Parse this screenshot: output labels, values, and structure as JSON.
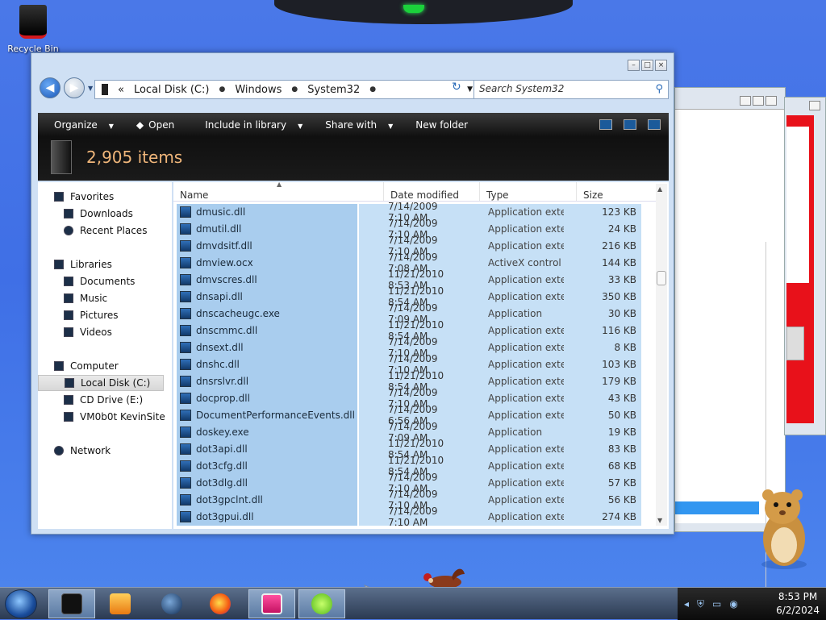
{
  "desktop": {
    "recycle_label": "Recycle Bin"
  },
  "window": {
    "nav": {
      "back": "◀",
      "forward": "▶"
    },
    "breadcrumb": [
      "Local Disk (C:)",
      "Windows",
      "System32"
    ],
    "search_placeholder": "Search System32",
    "toolbar": {
      "organize": "Organize",
      "open": "Open",
      "include": "Include in library",
      "share": "Share with",
      "new_folder": "New folder"
    },
    "item_count": "2,905 items",
    "sidebar": {
      "favorites": "Favorites",
      "downloads": "Downloads",
      "recent": "Recent Places",
      "libraries": "Libraries",
      "documents": "Documents",
      "music": "Music",
      "pictures": "Pictures",
      "videos": "Videos",
      "computer": "Computer",
      "local_disk": "Local Disk (C:)",
      "cd_drive": "CD Drive (E:)",
      "vm": "VM0b0t KevinSite",
      "network": "Network"
    },
    "columns": {
      "name": "Name",
      "date": "Date modified",
      "type": "Type",
      "size": "Size"
    },
    "files": [
      {
        "name": "dmusic.dll",
        "date": "7/14/2009 7:10 AM",
        "type": "Application extens...",
        "size": "123 KB"
      },
      {
        "name": "dmutil.dll",
        "date": "7/14/2009 7:10 AM",
        "type": "Application extens...",
        "size": "24 KB"
      },
      {
        "name": "dmvdsitf.dll",
        "date": "7/14/2009 7:10 AM",
        "type": "Application extens...",
        "size": "216 KB"
      },
      {
        "name": "dmview.ocx",
        "date": "7/14/2009 7:08 AM",
        "type": "ActiveX control",
        "size": "144 KB"
      },
      {
        "name": "dmvscres.dll",
        "date": "11/21/2010 8:53 AM",
        "type": "Application extens...",
        "size": "33 KB"
      },
      {
        "name": "dnsapi.dll",
        "date": "11/21/2010 8:54 AM",
        "type": "Application extens...",
        "size": "350 KB"
      },
      {
        "name": "dnscacheugc.exe",
        "date": "7/14/2009 7:09 AM",
        "type": "Application",
        "size": "30 KB"
      },
      {
        "name": "dnscmmc.dll",
        "date": "11/21/2010 8:54 AM",
        "type": "Application extens...",
        "size": "116 KB"
      },
      {
        "name": "dnsext.dll",
        "date": "7/14/2009 7:10 AM",
        "type": "Application extens...",
        "size": "8 KB"
      },
      {
        "name": "dnshc.dll",
        "date": "7/14/2009 7:10 AM",
        "type": "Application extens...",
        "size": "103 KB"
      },
      {
        "name": "dnsrslvr.dll",
        "date": "11/21/2010 8:54 AM",
        "type": "Application extens...",
        "size": "179 KB"
      },
      {
        "name": "docprop.dll",
        "date": "7/14/2009 7:10 AM",
        "type": "Application extens...",
        "size": "43 KB"
      },
      {
        "name": "DocumentPerformanceEvents.dll",
        "date": "7/14/2009 6:56 AM",
        "type": "Application extens...",
        "size": "50 KB"
      },
      {
        "name": "doskey.exe",
        "date": "7/14/2009 7:09 AM",
        "type": "Application",
        "size": "19 KB"
      },
      {
        "name": "dot3api.dll",
        "date": "11/21/2010 8:54 AM",
        "type": "Application extens...",
        "size": "83 KB"
      },
      {
        "name": "dot3cfg.dll",
        "date": "11/21/2010 8:54 AM",
        "type": "Application extens...",
        "size": "68 KB"
      },
      {
        "name": "dot3dlg.dll",
        "date": "7/14/2009 7:10 AM",
        "type": "Application extens...",
        "size": "57 KB"
      },
      {
        "name": "dot3gpclnt.dll",
        "date": "7/14/2009 7:10 AM",
        "type": "Application extens...",
        "size": "56 KB"
      },
      {
        "name": "dot3gpui.dll",
        "date": "7/14/2009 7:10 AM",
        "type": "Application extens...",
        "size": "274 KB"
      }
    ]
  },
  "taskbar": {
    "time": "8:53 PM",
    "date": "6/2/2024"
  }
}
